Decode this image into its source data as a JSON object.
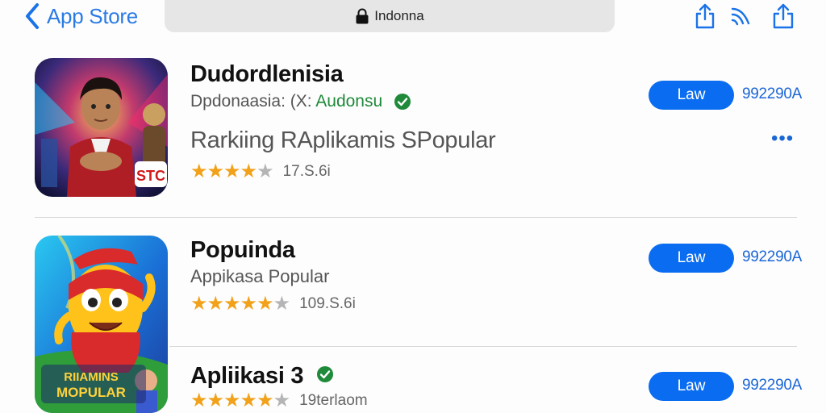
{
  "header": {
    "back_label": "App Store",
    "url": "Indonna",
    "icons": [
      "share-icon",
      "signal-icon",
      "share-icon"
    ]
  },
  "apps": [
    {
      "name": "Dudordlenisia",
      "subtitle_gray": "Dpdonaasia: (X: ",
      "subtitle_green": "Audonsu",
      "rank": "Rarkiing RAplikamis SPopular",
      "stars": 4,
      "rating_count": "17.S.6i",
      "get_label": "Law",
      "price": "992290A",
      "badge": "STC",
      "more_label": "•••"
    },
    {
      "name": "Popuinda",
      "subtitle": "Appikasa Popular",
      "stars": 5,
      "rating_count": "109.S.6i",
      "get_label": "Law",
      "price": "992290A",
      "art_text_1": "RIIAMINS",
      "art_text_2": "MOPULAR"
    },
    {
      "name": "Apliikasi 3",
      "stars": 5,
      "rating_count": "19terlaom",
      "get_label": "Law",
      "price": "992290A"
    }
  ],
  "colors": {
    "accent": "#0a6cf0",
    "link": "#1a66d6",
    "star": "#f1a21a",
    "verified": "#1f8a3a"
  }
}
